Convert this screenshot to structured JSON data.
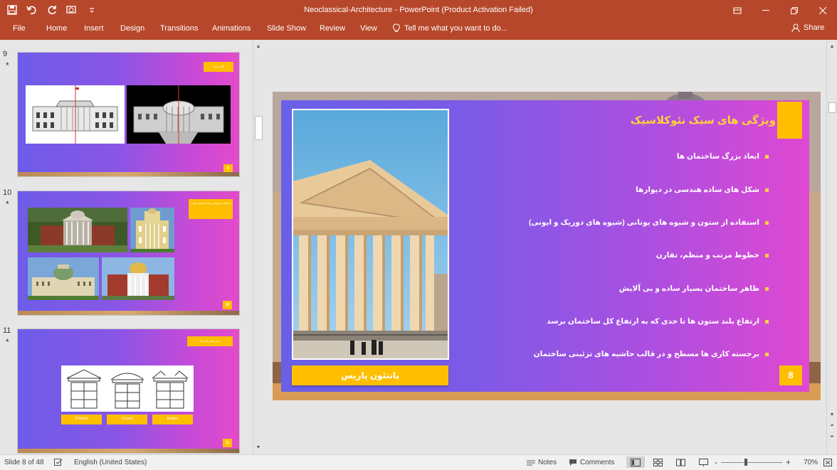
{
  "window": {
    "title": "Neoclassical-Architecture - PowerPoint (Product Activation Failed)"
  },
  "ribbon": {
    "tabs": [
      "File",
      "Home",
      "Insert",
      "Design",
      "Transitions",
      "Animations",
      "Slide Show",
      "Review",
      "View"
    ],
    "tell_me": "Tell me what you want to do...",
    "share": "Share"
  },
  "thumbnails": [
    {
      "number": "9",
      "star": "*",
      "tag": "کاخ سفید",
      "page": "9"
    },
    {
      "number": "10",
      "star": "*",
      "tag": "خانه‌های مونتیچلو و ساختمان‌های دولتی",
      "page": "10"
    },
    {
      "number": "11",
      "star": "*",
      "tag": "پنجره‌ها و قاب‌ها",
      "page": "11",
      "labels": [
        "Pointed",
        "Curved",
        "Broken"
      ]
    }
  ],
  "slide": {
    "title": "ویژگی های سبک نئوکلاسیک",
    "bullets": [
      "ابعاد بزرگ ساختمان ها",
      "شکل های ساده هندسی در دیوارها",
      "استفاده از ستون و شیوه های یونانی (شیوه های دوریک و ایونی)",
      "خطوط مرتب و منظم، تقارن",
      "ظاهر ساختمان بسیار ساده و بی آلایش",
      "ارتفاع بلند ستون ها تا حدی که به ارتفاع کل ساختمان برسد",
      "برجسته کاری ها مسطح و در قالب حاشیه های تزئینی ساختمان"
    ],
    "caption": "پانتئون پاریس",
    "number": "8"
  },
  "status": {
    "slide_info": "Slide 8 of 48",
    "language": "English (United States)",
    "notes": "Notes",
    "comments": "Comments",
    "zoom": "70%",
    "zoom_minus": "-",
    "zoom_plus": "+"
  },
  "colors": {
    "ribbon": "#b7472a",
    "accent": "#ffbf00",
    "title_yellow": "#ffd23a"
  }
}
